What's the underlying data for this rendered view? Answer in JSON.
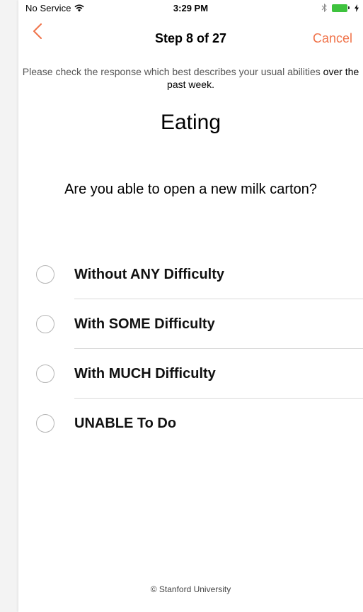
{
  "status_bar": {
    "carrier": "No Service",
    "time": "3:29 PM",
    "battery_color": "#3ec33e"
  },
  "nav": {
    "title": "Step 8 of 27",
    "cancel_label": "Cancel",
    "accent_color": "#f0734a",
    "back_icon": "chevron-left-icon"
  },
  "instruction": {
    "text": "Please check the response which best describes your usual abilities",
    "emphasis": "over the past week."
  },
  "section": {
    "title": "Eating"
  },
  "question": {
    "text": "Are you able to open a new milk carton?"
  },
  "options": [
    {
      "label": "Without ANY Difficulty",
      "selected": false
    },
    {
      "label": "With SOME Difficulty",
      "selected": false
    },
    {
      "label": "With MUCH Difficulty",
      "selected": false
    },
    {
      "label": "UNABLE To Do",
      "selected": false
    }
  ],
  "footer": {
    "text": "© Stanford University"
  }
}
